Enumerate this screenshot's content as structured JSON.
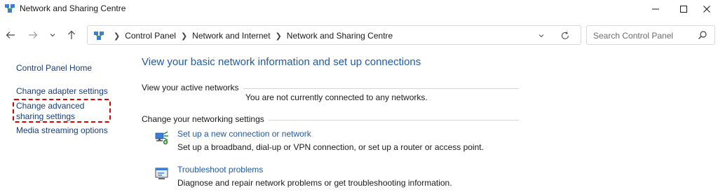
{
  "window": {
    "title": "Network and Sharing Centre"
  },
  "address": {
    "crumbs": [
      "Control Panel",
      "Network and Internet",
      "Network and Sharing Centre"
    ],
    "search_placeholder": "Search Control Panel"
  },
  "sidebar": {
    "items": [
      {
        "label": "Control Panel Home"
      },
      {
        "label": "Change adapter settings"
      },
      {
        "label": "Change advanced sharing settings"
      },
      {
        "label": "Media streaming options"
      }
    ]
  },
  "main": {
    "title": "View your basic network information and set up connections",
    "active_networks_label": "View your active networks",
    "no_network_text": "You are not currently connected to any networks.",
    "change_settings_label": "Change your networking settings",
    "tasks": [
      {
        "icon": "new-connection-icon",
        "link": "Set up a new connection or network",
        "desc": "Set up a broadband, dial-up or VPN connection, or set up a router or access point."
      },
      {
        "icon": "troubleshoot-icon",
        "link": "Troubleshoot problems",
        "desc": "Diagnose and repair network problems or get troubleshooting information."
      }
    ]
  },
  "colors": {
    "link": "#1e5aa8",
    "sidebar_link": "#1a3d7c",
    "highlight": "#e00000"
  }
}
